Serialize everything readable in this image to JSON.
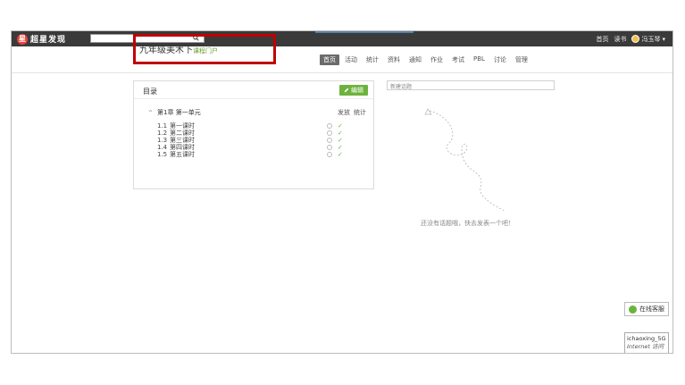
{
  "topbar": {
    "logo_text": "超星发现",
    "logo_mark": "星",
    "search_value": "",
    "links": {
      "home": "首页",
      "read": "读书",
      "user": "冯玉琴"
    },
    "user_caret": "▾"
  },
  "course": {
    "title": "九年级美术下",
    "subtitle": "课程门户",
    "nav": [
      "首页",
      "活动",
      "统计",
      "资料",
      "通知",
      "作业",
      "考试",
      "PBL",
      "讨论",
      "管理"
    ],
    "active_nav": "首页"
  },
  "catalog": {
    "title": "目录",
    "edit_label": "编辑",
    "chapter": {
      "caret": "^",
      "name": "第1章 第一单元"
    },
    "columns": {
      "publish": "发放",
      "stats": "统计"
    },
    "lessons": [
      {
        "num": "1.1",
        "name": "第一课时"
      },
      {
        "num": "1.2",
        "name": "第二课时"
      },
      {
        "num": "1.3",
        "name": "第三课时"
      },
      {
        "num": "1.4",
        "name": "第四课时"
      },
      {
        "num": "1.5",
        "name": "第五课时"
      }
    ]
  },
  "topics": {
    "new_topic_label": "新建话题",
    "empty_message": "还没有话题哦，快去发表一个吧！"
  },
  "widgets": {
    "service_label": "在线客服",
    "net_name": "ichaoxing_5G",
    "net_status": "Internet 访问"
  },
  "colors": {
    "topbar": "#3a3a3a",
    "accent_green": "#6cb33e",
    "highlight_red": "#c00000",
    "brand_red": "#e8413a"
  }
}
